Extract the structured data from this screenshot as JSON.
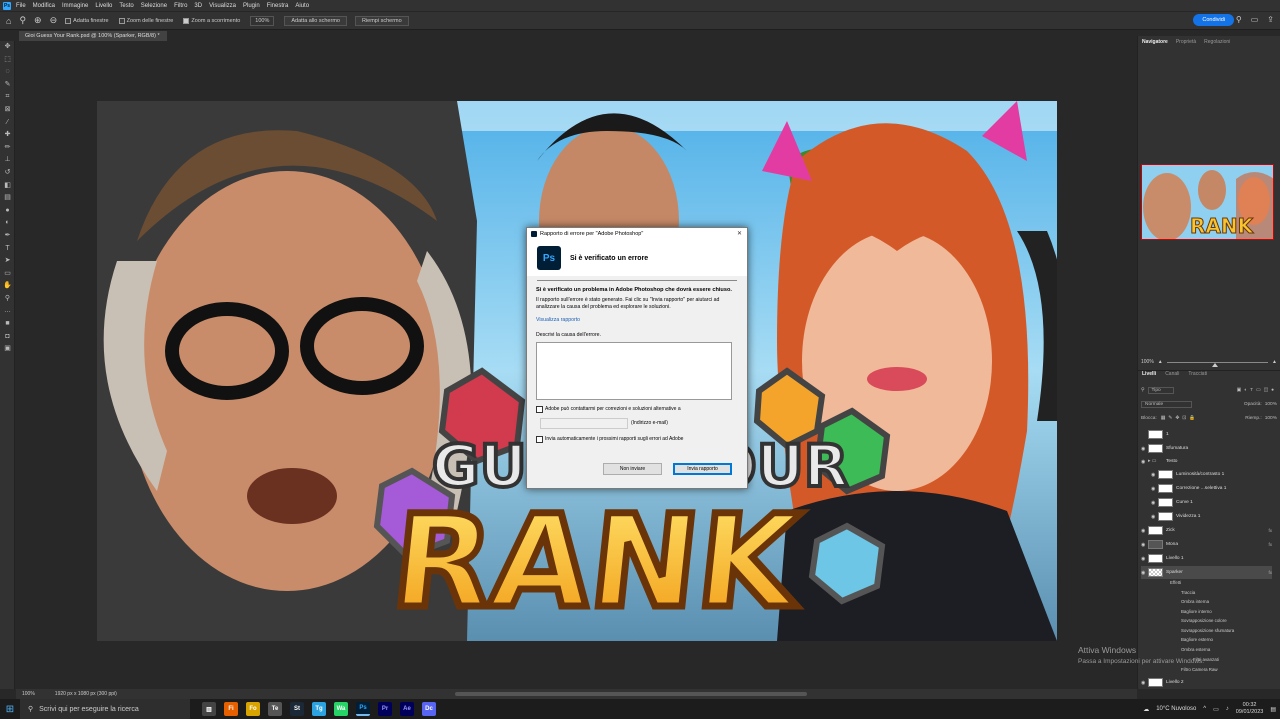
{
  "menu": [
    "File",
    "Modifica",
    "Immagine",
    "Livello",
    "Testo",
    "Selezione",
    "Filtro",
    "3D",
    "Visualizza",
    "Plugin",
    "Finestra",
    "Aiuto"
  ],
  "options": {
    "resize_windows": "Adatta finestre",
    "zoom_all": "Zoom delle finestre",
    "scrubby_zoom": "Zoom a scorrimento",
    "zoom_pct": "100%",
    "fit_screen": "Adatta allo schermo",
    "fill_screen": "Riempi schermo",
    "share": "Condividi"
  },
  "doc_tab": "Gioi Guess Your Rank.psd @ 100% (Sparker, RGB/8) *",
  "right_panel": {
    "tabs": [
      "Navigatore",
      "Proprietà",
      "Regolazioni"
    ],
    "zoom": "100%",
    "layer_tabs": [
      "Livelli",
      "Canali",
      "Tracciati"
    ],
    "kind_filter": "Tipo",
    "blend_mode": "Normale",
    "opacity_label": "Opacità:",
    "opacity_value": "100%",
    "lock_label": "Blocca:",
    "fill_label": "Riemp.:",
    "fill_value": "100%",
    "layers": [
      {
        "name": "1",
        "thumb": "white"
      },
      {
        "name": "Sfumatura",
        "thumb": "white"
      },
      {
        "name": "Testo",
        "thumb": "folder"
      },
      {
        "name": "Luminosità/contrasto 1",
        "thumb": "white"
      },
      {
        "name": "Correzione ...selettiva 1",
        "thumb": "white"
      },
      {
        "name": "Curve 1",
        "thumb": "white"
      },
      {
        "name": "Vividezza 1",
        "thumb": "white"
      },
      {
        "name": "Zick",
        "thumb": "white",
        "fx": "fx"
      },
      {
        "name": "Mona",
        "thumb": "dark",
        "fx": "fx"
      },
      {
        "name": "Livello 1",
        "thumb": "white"
      },
      {
        "name": "Sparker",
        "thumb": "chk",
        "fx": "fx"
      }
    ],
    "effects": [
      "Effetti",
      "Traccia",
      "Ombra interna",
      "Bagliore interno",
      "Sovrapposizione colore",
      "Sovrapposizione sfumatura",
      "Bagliore esterno",
      "Ombra esterna"
    ],
    "smart_filters": "Filtri avanzati",
    "camera_raw": "Filtro Camera Raw",
    "last_layer": "Livello 2"
  },
  "status": {
    "zoom": "100%",
    "doc_size": "1920 px x 1080 px (300 ppi)"
  },
  "watermark": {
    "line1": "Attiva Windows",
    "line2": "Passa a Impostazioni per attivare Windows."
  },
  "dialog": {
    "title": "Rapporto di errore per \"Adobe Photoshop\"",
    "heading": "Si è verificato un errore",
    "bold_text": "Si è verificato un problema in Adobe Photoshop che dovrà essere chiuso.",
    "body_text": "Il rapporto sull'errore è stato generato. Fai clic su \"Invia rapporto\" per aiutarci ad analizzare la causa del problema ed esplorare le soluzioni.",
    "view_link": "Visualizza rapporto",
    "describe_label": "Descrivi la causa dell'errore.",
    "contact_check": "Adobe può contattarmi per correzioni e soluzioni alternative a",
    "email_label": "(Indirizzo e-mail)",
    "auto_send": "Invia automaticamente i prossimi rapporti sugli errori ad Adobe",
    "btn_dont_send": "Non inviare",
    "btn_send": "Invia rapporto"
  },
  "artwork": {
    "title_line1": "GUESS YOUR",
    "title_line2": "RANK"
  },
  "taskbar": {
    "search_placeholder": "Scrivi qui per eseguire la ricerca",
    "apps": [
      "Fi",
      "Fo",
      "Te",
      "St",
      "Tg",
      "Wa",
      "Ps",
      "Pr",
      "Ae",
      "Dc"
    ],
    "weather": "10°C  Nuvoloso",
    "time": "00:32",
    "date": "09/01/2023"
  },
  "colors": {
    "ps_blue": "#31a8ff",
    "share_blue": "#1473e6",
    "link_blue": "#1a5fb4"
  }
}
